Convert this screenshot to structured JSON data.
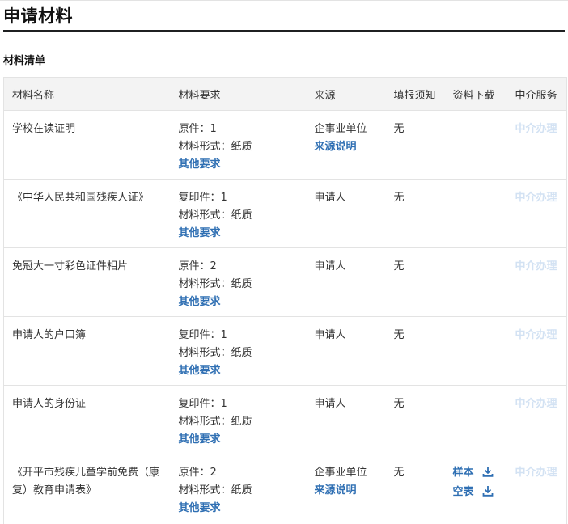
{
  "page_title": "申请材料",
  "section_title": "材料清单",
  "headers": [
    "材料名称",
    "材料要求",
    "来源",
    "填报须知",
    "资料下载",
    "中介服务"
  ],
  "labels": {
    "other_requirements": "其他要求",
    "source_note": "来源说明",
    "agency_service": "中介办理",
    "sample": "样本",
    "blank_form": "空表"
  },
  "colors": {
    "link": "#2f6fb3",
    "disabled_link": "#d3e2f3",
    "header_bg": "#f3f3f3",
    "rule": "#1f2021"
  },
  "rows": [
    {
      "name": "学校在读证明",
      "req_copy": "原件：1",
      "req_form": "材料形式：纸质",
      "source": "企事业单位",
      "notice": "无"
    },
    {
      "name": "《中华人民共和国残疾人证》",
      "req_copy": "复印件：1",
      "req_form": "材料形式：纸质",
      "source": "申请人",
      "notice": "无"
    },
    {
      "name": "免冠大一寸彩色证件相片",
      "req_copy": "原件：2",
      "req_form": "材料形式：纸质",
      "source": "申请人",
      "notice": "无"
    },
    {
      "name": "申请人的户口簿",
      "req_copy": "复印件：1",
      "req_form": "材料形式：纸质",
      "source": "申请人",
      "notice": "无"
    },
    {
      "name": "申请人的身份证",
      "req_copy": "复印件：1",
      "req_form": "材料形式：纸质",
      "source": "申请人",
      "notice": "无"
    },
    {
      "name": "《开平市残疾儿童学前免费（康复）教育申请表》",
      "req_copy": "原件：2",
      "req_form": "材料形式：纸质",
      "source": "企事业单位",
      "notice": "无"
    }
  ]
}
